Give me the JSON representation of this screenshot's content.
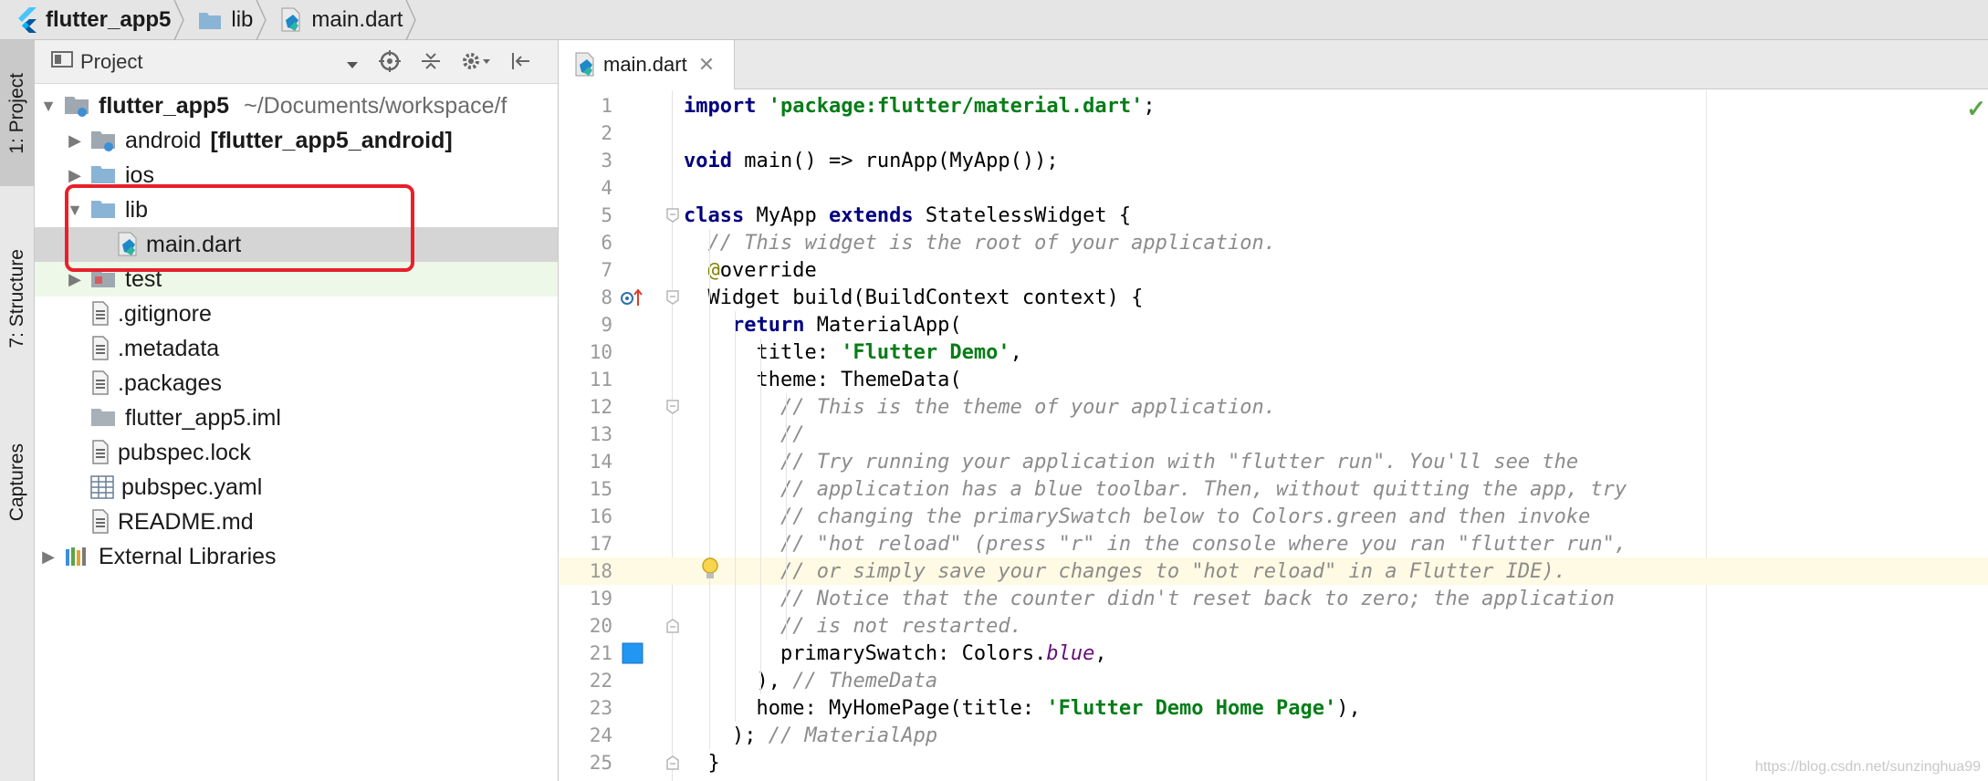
{
  "breadcrumb": [
    {
      "label": "flutter_app5",
      "icon": "flutter-icon"
    },
    {
      "label": "lib",
      "icon": "folder-icon"
    },
    {
      "label": "main.dart",
      "icon": "dart-file-icon"
    }
  ],
  "toolstrip": {
    "project_tab": "1: Project",
    "structure_tab": "7: Structure",
    "captures_tab": "Captures"
  },
  "project_panel": {
    "title": "Project",
    "tree": [
      {
        "label": "flutter_app5",
        "extra": "~/Documents/workspace/f",
        "icon": "module-folder-icon",
        "arrow": "expanded"
      },
      {
        "label": "android",
        "extra": "[flutter_app5_android]",
        "icon": "module-folder-icon",
        "arrow": "collapsed"
      },
      {
        "label": "ios",
        "extra": "",
        "icon": "folder-icon",
        "arrow": "collapsed"
      },
      {
        "label": "lib",
        "extra": "",
        "icon": "folder-icon",
        "arrow": "expanded"
      },
      {
        "label": "main.dart",
        "extra": "",
        "icon": "dart-file-icon",
        "arrow": ""
      },
      {
        "label": "test",
        "extra": "",
        "icon": "test-folder-icon",
        "arrow": "collapsed"
      },
      {
        "label": ".gitignore",
        "extra": "",
        "icon": "text-file-icon",
        "arrow": ""
      },
      {
        "label": ".metadata",
        "extra": "",
        "icon": "text-file-icon",
        "arrow": ""
      },
      {
        "label": ".packages",
        "extra": "",
        "icon": "text-file-icon",
        "arrow": ""
      },
      {
        "label": "flutter_app5.iml",
        "extra": "",
        "icon": "module-file-icon",
        "arrow": ""
      },
      {
        "label": "pubspec.lock",
        "extra": "",
        "icon": "text-file-icon",
        "arrow": ""
      },
      {
        "label": "pubspec.yaml",
        "extra": "",
        "icon": "yaml-table-icon",
        "arrow": ""
      },
      {
        "label": "README.md",
        "extra": "",
        "icon": "text-file-icon",
        "arrow": ""
      },
      {
        "label": "External Libraries",
        "extra": "",
        "icon": "libraries-icon",
        "arrow": "collapsed"
      }
    ]
  },
  "editor": {
    "tab_label": "main.dart",
    "caret_line": 18,
    "lines": [
      [
        [
          "kw",
          "import"
        ],
        [
          "t",
          " "
        ],
        [
          "str",
          "'package:flutter/material.dart'"
        ],
        [
          "t",
          ";"
        ]
      ],
      [],
      [
        [
          "kw",
          "void"
        ],
        [
          "t",
          " main() => runApp(MyApp());"
        ]
      ],
      [],
      [
        [
          "kw",
          "class"
        ],
        [
          "t",
          " MyApp "
        ],
        [
          "kw",
          "extends"
        ],
        [
          "t",
          " StatelessWidget {"
        ]
      ],
      [
        [
          "t",
          "  "
        ],
        [
          "cm",
          "// This widget is the root of your application."
        ]
      ],
      [
        [
          "t",
          "  "
        ],
        [
          "ann",
          "@"
        ],
        [
          "t",
          "override"
        ]
      ],
      [
        [
          "t",
          "  Widget build(BuildContext context) {"
        ]
      ],
      [
        [
          "t",
          "    "
        ],
        [
          "kw",
          "return"
        ],
        [
          "t",
          " MaterialApp("
        ]
      ],
      [
        [
          "t",
          "      title: "
        ],
        [
          "str",
          "'Flutter Demo'"
        ],
        [
          "t",
          ","
        ]
      ],
      [
        [
          "t",
          "      theme: ThemeData("
        ]
      ],
      [
        [
          "t",
          "        "
        ],
        [
          "cm",
          "// This is the theme of your application."
        ]
      ],
      [
        [
          "t",
          "        "
        ],
        [
          "cm",
          "//"
        ]
      ],
      [
        [
          "t",
          "        "
        ],
        [
          "cm",
          "// Try running your application with \"flutter run\". You'll see the"
        ]
      ],
      [
        [
          "t",
          "        "
        ],
        [
          "cm",
          "// application has a blue toolbar. Then, without quitting the app, try"
        ]
      ],
      [
        [
          "t",
          "        "
        ],
        [
          "cm",
          "// changing the primarySwatch below to Colors.green and then invoke"
        ]
      ],
      [
        [
          "t",
          "        "
        ],
        [
          "cm",
          "// \"hot reload\" (press \"r\" in the console where you ran \"flutter run\","
        ]
      ],
      [
        [
          "t",
          "        "
        ],
        [
          "cm",
          "// or simply save your changes to \"hot reload\" in a Flutter IDE)."
        ]
      ],
      [
        [
          "t",
          "        "
        ],
        [
          "cm",
          "// Notice that the counter didn't reset back to zero; the application"
        ]
      ],
      [
        [
          "t",
          "        "
        ],
        [
          "cm",
          "// is not restarted."
        ]
      ],
      [
        [
          "t",
          "        primarySwatch: Colors."
        ],
        [
          "const",
          "blue"
        ],
        [
          "t",
          ","
        ]
      ],
      [
        [
          "t",
          "      ), "
        ],
        [
          "cm",
          "// ThemeData"
        ]
      ],
      [
        [
          "t",
          "      home: MyHomePage(title: "
        ],
        [
          "str",
          "'Flutter Demo Home Page'"
        ],
        [
          "t",
          "),"
        ]
      ],
      [
        [
          "t",
          "    ); "
        ],
        [
          "cm",
          "// MaterialApp"
        ]
      ],
      [
        [
          "t",
          "  }"
        ]
      ]
    ]
  },
  "watermark": "https://blog.csdn.net/sunzinghua99",
  "colors": {
    "keyword": "#000080",
    "string": "#067d17",
    "comment": "#8c8c8c",
    "swatch_blue": "#2196f3",
    "highlight_box": "#e8202a"
  }
}
